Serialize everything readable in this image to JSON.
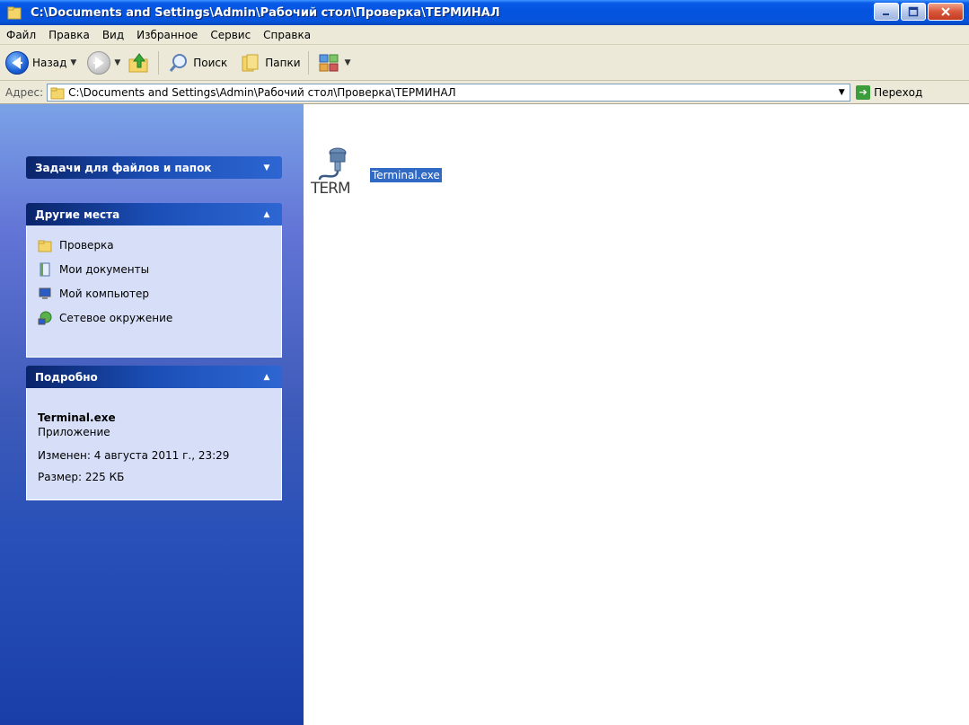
{
  "window": {
    "title": "C:\\Documents and Settings\\Admin\\Рабочий стол\\Проверка\\ТЕРМИНАЛ"
  },
  "menu": [
    "Файл",
    "Правка",
    "Вид",
    "Избранное",
    "Сервис",
    "Справка"
  ],
  "toolbar": {
    "back_label": "Назад",
    "search_label": "Поиск",
    "folders_label": "Папки"
  },
  "address": {
    "label": "Адрес:",
    "value": "C:\\Documents and Settings\\Admin\\Рабочий стол\\Проверка\\ТЕРМИНАЛ",
    "go_label": "Переход"
  },
  "taskpane": {
    "file_tasks": {
      "title": "Задачи для файлов и папок"
    },
    "other_places": {
      "title": "Другие места",
      "items": [
        {
          "label": "Проверка",
          "icon": "folder-icon"
        },
        {
          "label": "Мои документы",
          "icon": "documents-icon"
        },
        {
          "label": "Мой компьютер",
          "icon": "computer-icon"
        },
        {
          "label": "Сетевое окружение",
          "icon": "network-icon"
        }
      ]
    },
    "details": {
      "title": "Подробно",
      "name": "Terminal.exe",
      "type": "Приложение",
      "modified": "Изменен: 4 августа 2011 г., 23:29",
      "size": "Размер: 225 КБ"
    }
  },
  "files": [
    {
      "name": "Terminal.exe",
      "icon_text": "TERM",
      "selected": true
    }
  ],
  "colors": {
    "titlebar": "#0454e1",
    "selection": "#316ac5",
    "taskpane_body": "#d6dff7"
  }
}
